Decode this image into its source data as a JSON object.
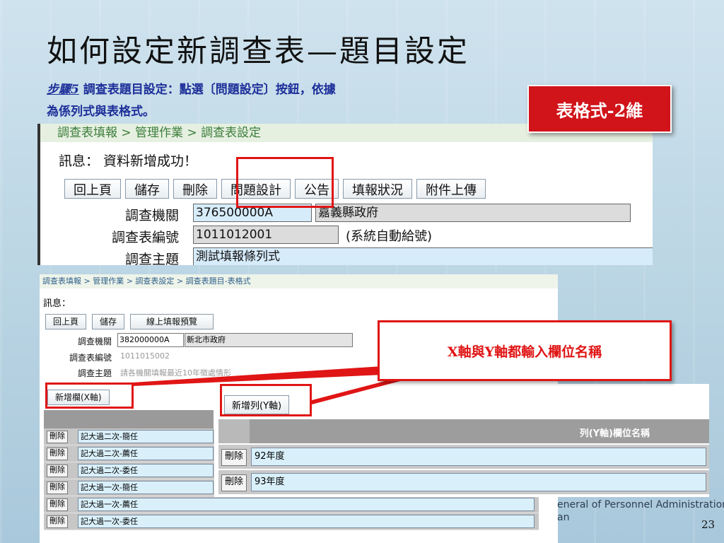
{
  "slide": {
    "title": "如何設定新調查表—題目設定",
    "step_lead": "步驟5",
    "step_text": " 調查表題目設定：點選〔問題設定〕按鈕，依據",
    "step_text2": "為係列式與表格式。",
    "badge": "表格式-2維",
    "callout": "X軸與Y軸都輸入欄位名稱",
    "footer_line1": "eneral of Personnel Administration,",
    "footer_line2": "an",
    "page_number": "23"
  },
  "panel_top": {
    "breadcrumb": "調查表填報 > 管理作業 > 調查表設定",
    "message": "訊息： 資料新增成功！",
    "buttons": [
      "回上頁",
      "儲存",
      "刪除",
      "問題設計",
      "公告",
      "填報狀況",
      "附件上傳"
    ],
    "rows": [
      {
        "label": "調查機關",
        "code": "376500000A",
        "value": "嘉義縣政府"
      },
      {
        "label": "調查表編號",
        "code": "1011012001",
        "value": "(系統自動給號)"
      },
      {
        "label": "調查主題",
        "value": "測試填報條列式"
      }
    ]
  },
  "panel_bottom": {
    "breadcrumb": "調查表填報 > 管理作業 > 調查表設定 > 調查表題目-表格式",
    "message": "訊息：",
    "buttons": [
      "回上頁",
      "儲存",
      "線上填報預覽"
    ],
    "rows": [
      {
        "label": "調查機關",
        "code": "382000000A",
        "value": "新北市政府"
      },
      {
        "label": "調查表編號",
        "value": "1011015002"
      },
      {
        "label": "調查主題",
        "value": "請各機關填報最近10年徵處情形"
      }
    ],
    "add_col_button": "新增欄(X軸)",
    "delete_label": "刪除",
    "x_items": [
      "記大過二次-簡任",
      "記大過二次-薦任",
      "記大過二次-委任",
      "記大過一次-簡任",
      "記大過一次-薦任",
      "記大過一次-委任"
    ]
  },
  "panel_y": {
    "add_row_button": "新增列(Y軸)",
    "column_header": "列(Y軸)欄位名稱",
    "delete_label": "刪除",
    "y_items": [
      "92年度",
      "93年度"
    ]
  }
}
